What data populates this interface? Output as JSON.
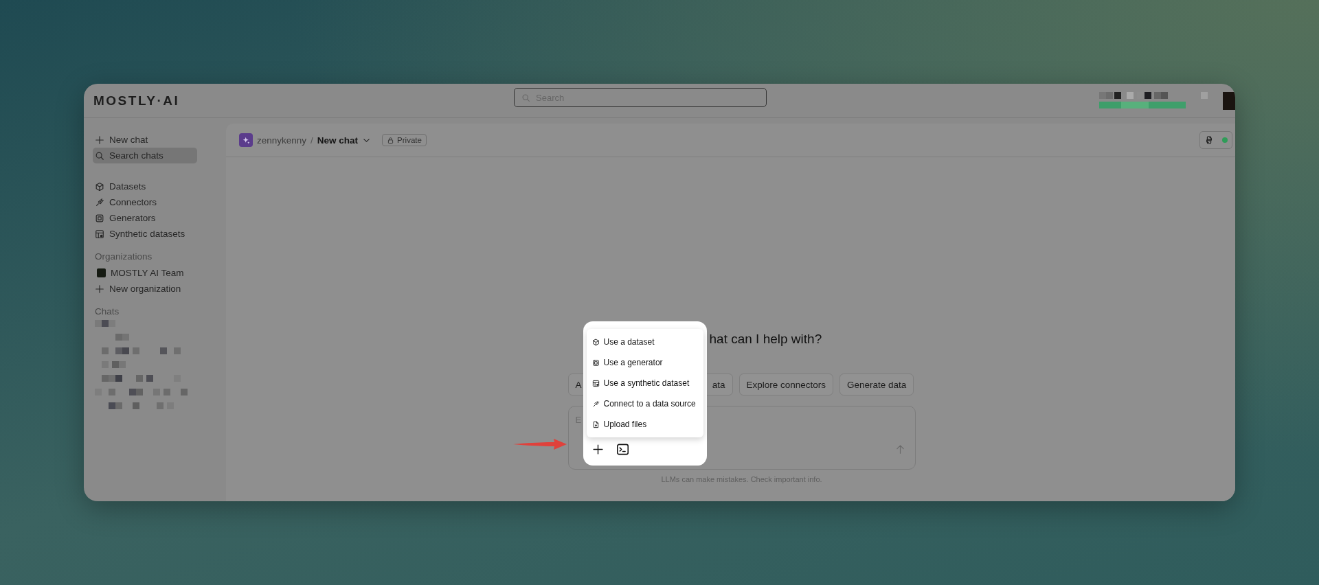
{
  "brand": {
    "name": "MOSTLY·AI"
  },
  "search": {
    "placeholder": "Search"
  },
  "sidebar": {
    "actions": [
      {
        "label": "New chat",
        "selected": false
      },
      {
        "label": "Search chats",
        "selected": true
      }
    ],
    "nav": [
      {
        "label": "Datasets"
      },
      {
        "label": "Connectors"
      },
      {
        "label": "Generators"
      },
      {
        "label": "Synthetic datasets"
      }
    ],
    "organizations_heading": "Organizations",
    "organizations": [
      {
        "label": "MOSTLY AI Team",
        "kind": "org"
      },
      {
        "label": "New organization",
        "kind": "add"
      }
    ],
    "chats_heading": "Chats"
  },
  "header": {
    "owner": "zennykenny",
    "separator": "/",
    "chat_title": "New chat",
    "visibility": "Private",
    "status_on": true
  },
  "heading": "hat can I help with?",
  "suggestions": [
    {
      "label": "A",
      "kind": "cutright"
    },
    {
      "label": "ata",
      "kind": "cutleft"
    },
    {
      "label": "Explore connectors",
      "kind": "full"
    },
    {
      "label": "Generate data",
      "kind": "full"
    }
  ],
  "composer": {
    "placeholder": "E"
  },
  "menu": [
    {
      "label": "Use a dataset"
    },
    {
      "label": "Use a generator"
    },
    {
      "label": "Use a synthetic dataset"
    },
    {
      "label": "Connect to a data source"
    },
    {
      "label": "Upload files"
    }
  ],
  "disclaimer": "LLMs can make mistakes. Check important info."
}
